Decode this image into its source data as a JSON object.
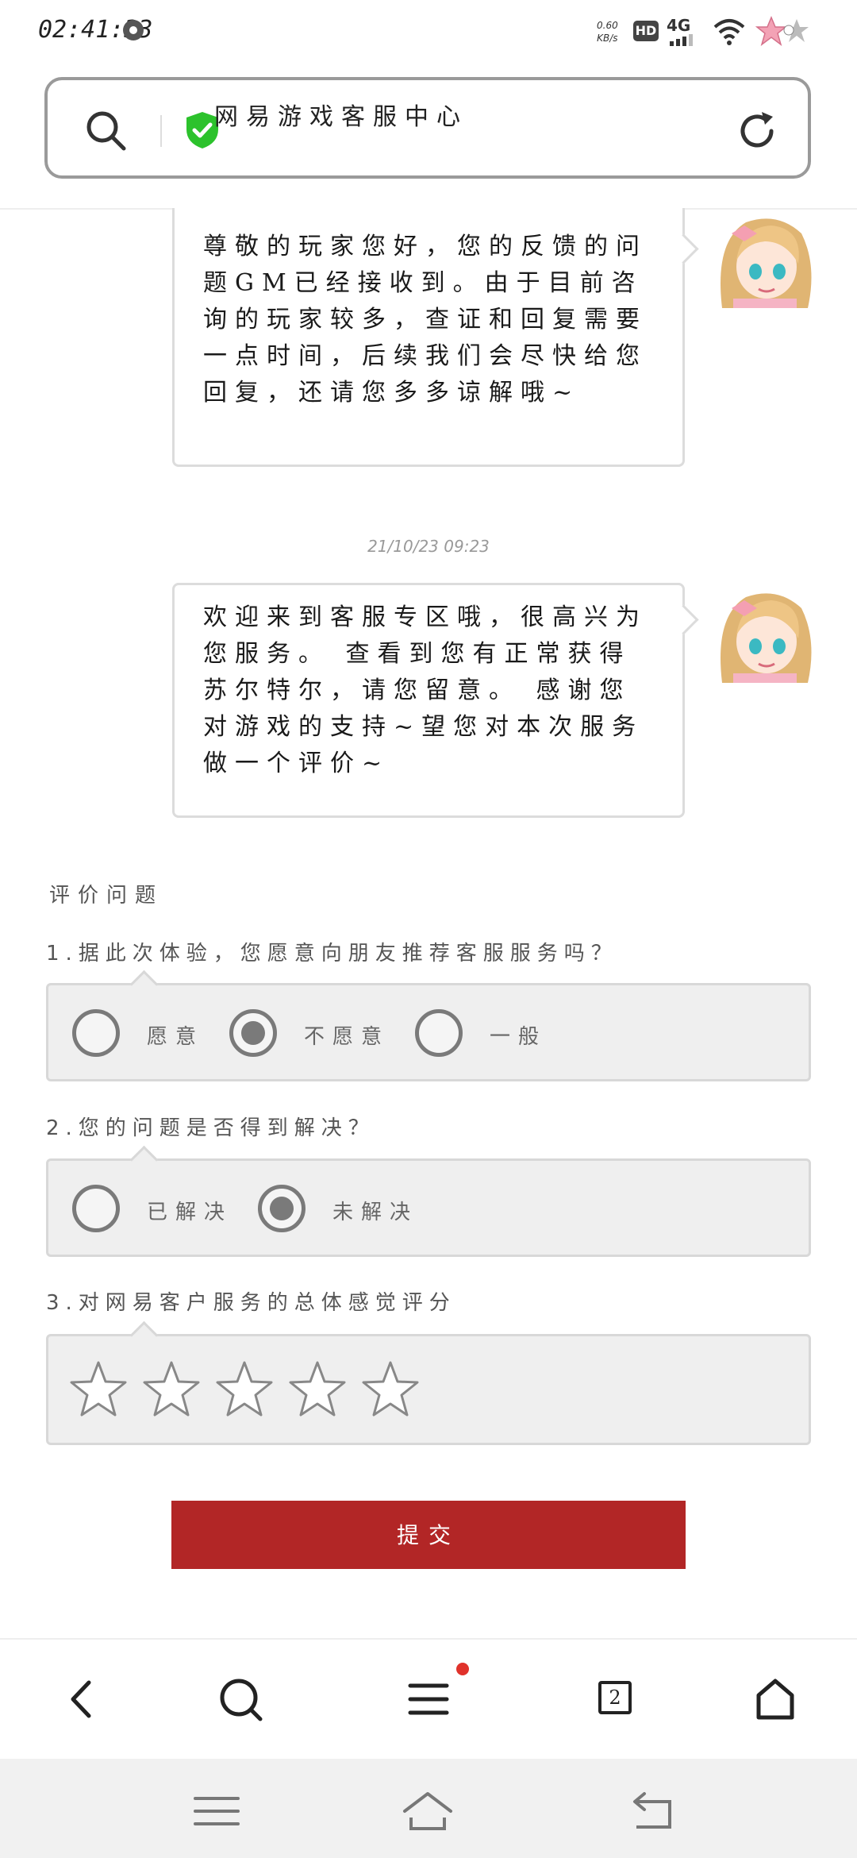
{
  "status_bar": {
    "time": "02:41:33",
    "net_speed": "0.60",
    "net_speed_unit": "KB/s",
    "hd_label": "HD",
    "network": "4G"
  },
  "address_bar": {
    "page_title": "网易游戏客服中心",
    "search_icon": "search-icon",
    "secure_icon": "shield-check-icon",
    "reload_icon": "reload-icon"
  },
  "chat": {
    "message1": "尊敬的玩家您好，您的反馈的问题GM已经接收到。由于目前咨询的玩家较多，查证和回复需要一点时间，后续我们会尽快给您回复，还请您多多谅解哦~",
    "timestamp": "21/10/23 09:23",
    "message2": "欢迎来到客服专区哦，很高兴为您服务。 查看到您有正常获得苏尔特尔，请您留意。 感谢您对游戏的支持~望您对本次服务做一个评价~"
  },
  "survey": {
    "title": "评价问题",
    "q1": {
      "label": "1.据此次体验，您愿意向朋友推荐客服服务吗？",
      "options": [
        "愿意",
        "不愿意",
        "一般"
      ],
      "selected": "不愿意"
    },
    "q2": {
      "label": "2.您的问题是否得到解决？",
      "options": [
        "已解决",
        "未解决"
      ],
      "selected": "未解决"
    },
    "q3": {
      "label": "3.对网易客户服务的总体感觉评分",
      "rating": 0,
      "max_rating": 5
    },
    "submit_label": "提交"
  },
  "browser_toolbar": {
    "tab_count": "2",
    "icons": [
      "back-icon",
      "search-icon",
      "menu-icon",
      "tabs-icon",
      "home-icon"
    ]
  },
  "system_nav": {
    "icons": [
      "menu-icon",
      "home-icon",
      "back-icon"
    ]
  },
  "colors": {
    "accent": "#b22626",
    "secure": "#2cc22c",
    "badge": "#e0322b"
  }
}
